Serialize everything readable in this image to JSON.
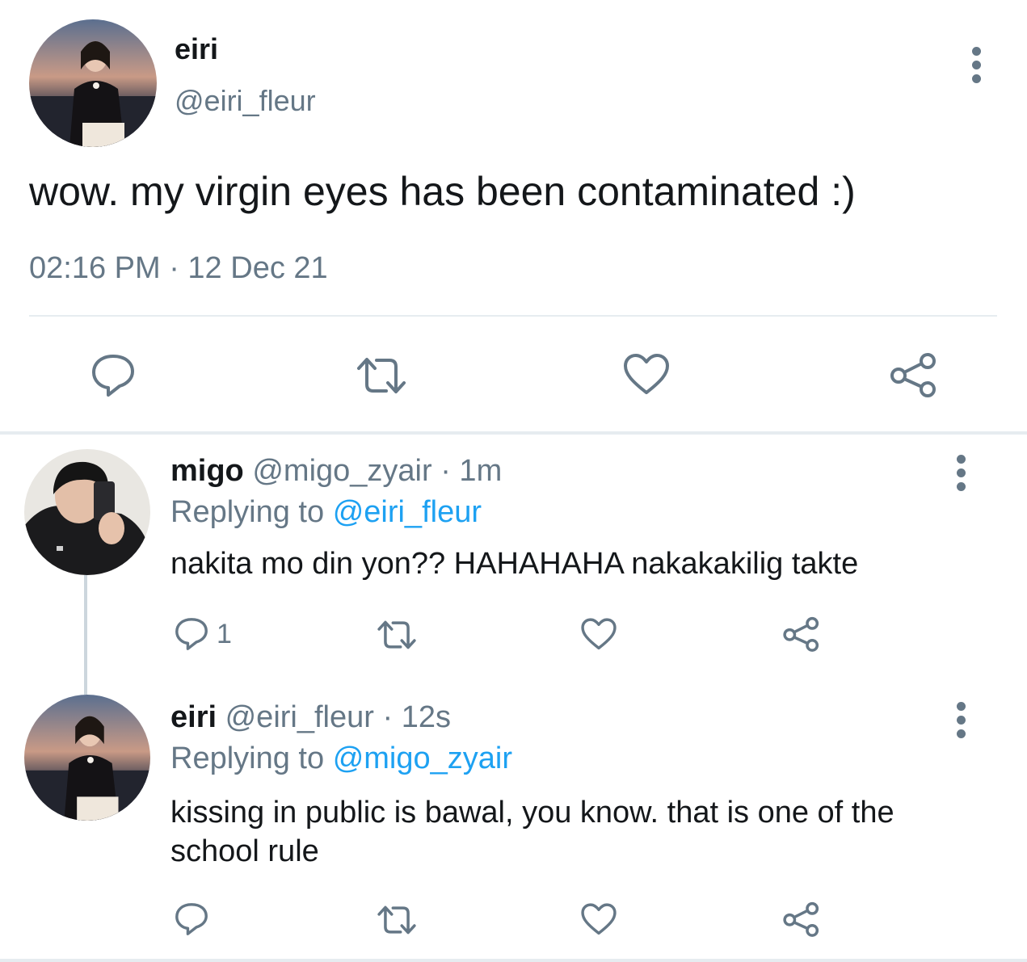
{
  "main_tweet": {
    "author_name": "eiri",
    "author_handle": "@eiri_fleur",
    "text": "wow. my virgin eyes has been contaminated :)",
    "timestamp": "02:16 PM · 12 Dec 21",
    "avatar_icon": "profile-photo-woman-icon"
  },
  "replies": [
    {
      "author_name": "migo",
      "author_handle": "@migo_zyair",
      "time": "· 1m",
      "replying_prefix": "Replying to",
      "replying_to": "@eiri_fleur",
      "text": "nakita mo din yon?? HAHAHAHA nakakakilig takte",
      "reply_count": "1"
    },
    {
      "author_name": "eiri",
      "author_handle": "@eiri_fleur",
      "time": "· 12s",
      "replying_prefix": "Replying to",
      "replying_to": "@migo_zyair",
      "text": "kissing in public is bawal, you know. that is one of the school rule",
      "reply_count": ""
    }
  ],
  "colors": {
    "link": "#1da1f2",
    "muted": "#657786",
    "text": "#14171a",
    "divider": "#e1e8ed"
  }
}
